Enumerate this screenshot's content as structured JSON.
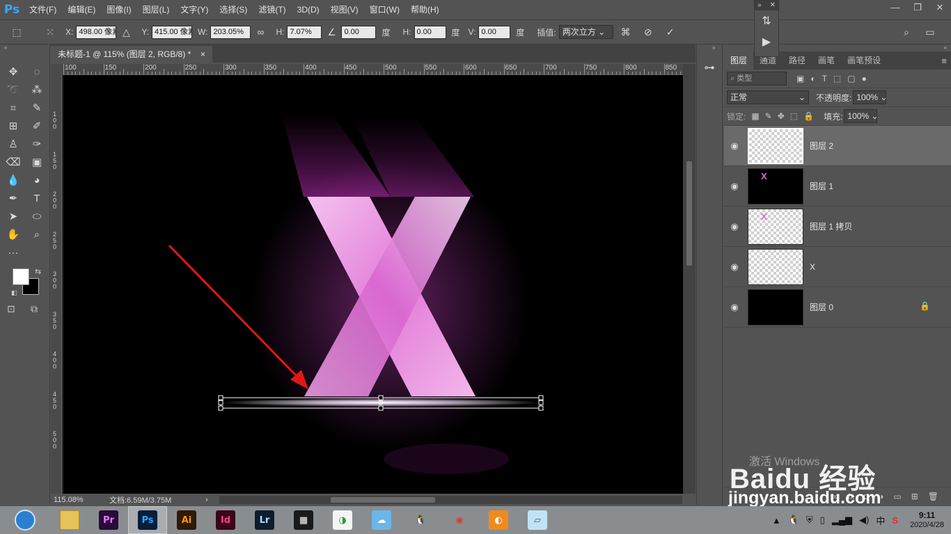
{
  "app": {
    "logo": "Ps"
  },
  "menu": [
    "文件(F)",
    "编辑(E)",
    "图像(I)",
    "图层(L)",
    "文字(Y)",
    "选择(S)",
    "滤镜(T)",
    "3D(D)",
    "视图(V)",
    "窗口(W)",
    "帮助(H)"
  ],
  "window_controls": {
    "minimize": "—",
    "restore": "❐",
    "close": "✕"
  },
  "options": {
    "x_label": "X:",
    "x_value": "498.00 像素",
    "y_label": "Y:",
    "y_value": "415.00 像素",
    "w_label": "W:",
    "w_value": "203.05%",
    "h_label": "H:",
    "h_value": "7.07%",
    "angle_value": "0.00",
    "angle_unit": "度",
    "hskew_label": "H:",
    "hskew_value": "0.00",
    "hskew_unit": "度",
    "vskew_label": "V:",
    "vskew_value": "0.00",
    "vskew_unit": "度",
    "interp_label": "插值:",
    "interp_value": "两次立方"
  },
  "document": {
    "tab_title": "未标题-1 @ 115% (图层 2, RGB/8) *",
    "tab_close": "×",
    "zoom": "115.08%",
    "doc_info": "文档:6.59M/3.75M"
  },
  "ruler_h": [
    "100",
    "150",
    "200",
    "250",
    "300",
    "350",
    "400",
    "450",
    "500",
    "550",
    "600",
    "650",
    "700",
    "750",
    "800",
    "850"
  ],
  "ruler_v": [
    "1 0 0",
    "1 5 0",
    "2 0 0",
    "2 5 0",
    "3 0 0",
    "3 5 0",
    "4 0 0",
    "4 5 0",
    "5 0 0"
  ],
  "panel": {
    "tabs": [
      "图层",
      "通道",
      "路径",
      "画笔",
      "画笔预设"
    ],
    "filter_label": "类型",
    "blend_mode": "正常",
    "opacity_label": "不透明度:",
    "opacity_value": "100%",
    "lock_label": "锁定:",
    "fill_label": "填充:",
    "fill_value": "100%",
    "layers": [
      {
        "name": "图层 2",
        "thumb": "transparent",
        "selected": true,
        "locked": false,
        "mark": ""
      },
      {
        "name": "图层 1",
        "thumb": "black",
        "selected": false,
        "locked": false,
        "mark": "X"
      },
      {
        "name": "图层 1 拷贝",
        "thumb": "transparent",
        "selected": false,
        "locked": false,
        "mark": "X"
      },
      {
        "name": "X",
        "thumb": "transparent",
        "selected": false,
        "locked": false,
        "mark": ""
      },
      {
        "name": "图层 0",
        "thumb": "black",
        "selected": false,
        "locked": true,
        "mark": ""
      }
    ]
  },
  "watermark": {
    "activate": "激活 Windows",
    "brand": "Baidu 经验",
    "url": "jingyan.baidu.com"
  },
  "taskbar": {
    "apps": [
      {
        "name": "file-explorer",
        "label": "",
        "color": "#e8c35a",
        "text_color": "#5a4a10",
        "active": false
      },
      {
        "name": "premiere",
        "label": "Pr",
        "color": "#2a0a3a",
        "text_color": "#e77bff",
        "active": false
      },
      {
        "name": "photoshop",
        "label": "Ps",
        "color": "#061e3a",
        "text_color": "#31a8ff",
        "active": true
      },
      {
        "name": "illustrator",
        "label": "Ai",
        "color": "#2e1a05",
        "text_color": "#ff9a00",
        "active": false
      },
      {
        "name": "indesign",
        "label": "Id",
        "color": "#3a0519",
        "text_color": "#ff3f8e",
        "active": false
      },
      {
        "name": "lightroom",
        "label": "Lr",
        "color": "#0c1e2e",
        "text_color": "#addcff",
        "active": false
      },
      {
        "name": "video-editor",
        "label": "▦",
        "color": "#1a1a1a",
        "text_color": "#ffffff",
        "active": false
      },
      {
        "name": "color-app",
        "label": "◑",
        "color": "#f4f4f4",
        "text_color": "#1f9d3a",
        "active": false
      },
      {
        "name": "chat-app",
        "label": "☁",
        "color": "#6ab7e8",
        "text_color": "#ffffff",
        "active": false
      },
      {
        "name": "qq",
        "label": "🐧",
        "color": "transparent",
        "text_color": "#111111",
        "active": false
      },
      {
        "name": "chrome",
        "label": "◉",
        "color": "transparent",
        "text_color": "#d63b2f",
        "active": false
      },
      {
        "name": "browser-orange",
        "label": "◐",
        "color": "#f08a1e",
        "text_color": "#ffffff",
        "active": false
      },
      {
        "name": "notepad",
        "label": "▱",
        "color": "#bfe3f5",
        "text_color": "#2a6b8a",
        "active": false
      }
    ],
    "time": "9:11",
    "date": "2020/4/28",
    "ime": "中"
  },
  "colors": {
    "accent": "#31a8ff",
    "glow": "#e66cd8",
    "arrow": "#e01818"
  }
}
